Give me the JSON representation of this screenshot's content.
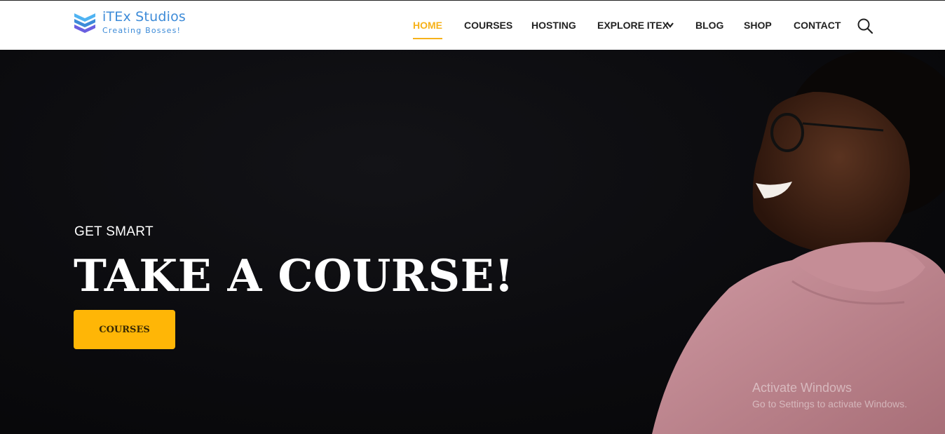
{
  "brand": {
    "name": "iTEx Studios",
    "tagline": "Creating Bosses!",
    "color": "#3d8bd8"
  },
  "nav": {
    "items": [
      {
        "label": "HOME",
        "active": true
      },
      {
        "label": "COURSES",
        "active": false
      },
      {
        "label": "HOSTING",
        "active": false
      },
      {
        "label": "EXPLORE ITEX",
        "active": false,
        "has_dropdown": true
      },
      {
        "label": "BLOG",
        "active": false
      },
      {
        "label": "SHOP",
        "active": false
      },
      {
        "label": "CONTACT",
        "active": false
      }
    ],
    "search_icon": "search-icon",
    "accent_color": "#f6b21b"
  },
  "hero": {
    "eyebrow": "GET SMART",
    "headline": "TAKE A COURSE!",
    "cta_label": "COURSES",
    "cta_color": "#ffb606"
  },
  "watermark": {
    "title": "Activate Windows",
    "subtitle": "Go to Settings to activate Windows."
  }
}
